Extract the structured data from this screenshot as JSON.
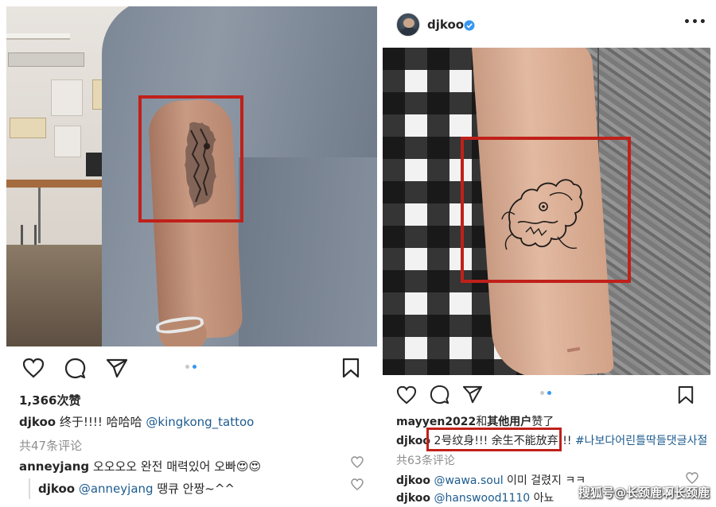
{
  "left_post": {
    "likes": "1,366次赞",
    "caption": {
      "username": "djkoo",
      "text": " 终于!!!! 哈哈哈 ",
      "mention": "@kingkong_tattoo"
    },
    "comments_count": "共47条评论",
    "comments": [
      {
        "username": "anneyjang",
        "text": " 오오오오 완전 매력있어 오빠",
        "emoji": "😍😍"
      },
      {
        "username": "djkoo",
        "mention": "@anneyjang",
        "text": " 땡큐 안짱~^^"
      }
    ],
    "carousel": {
      "count": 2,
      "active": 2
    }
  },
  "right_post": {
    "header": {
      "username": "djkoo",
      "verified": true,
      "menu": "•••"
    },
    "liked_by": {
      "user": "mayyen2022",
      "middle": "和",
      "others": "其他用户",
      "suffix": "赞了"
    },
    "caption": {
      "username": "djkoo",
      "text": " 2号纹身!!! 余生不能放弃!!! ",
      "hashtag": "#나보다어린틀딱들댓글사절"
    },
    "comments_count": "共63条评论",
    "comments": [
      {
        "username": "djkoo",
        "mention": "@wawa.soul",
        "text": " 이미 걸렸지 ㅋㅋ"
      },
      {
        "username": "djkoo",
        "mention": "@hanswood1110",
        "text": " 아뇨"
      }
    ],
    "carousel": {
      "count": 2,
      "active": 2
    }
  },
  "watermark": "搜狐号@长颈鹿啊长颈鹿",
  "colors": {
    "highlight": "#c0201a",
    "link": "#1d5b8f",
    "muted": "#8e8e8e",
    "verified": "#3897f0"
  }
}
